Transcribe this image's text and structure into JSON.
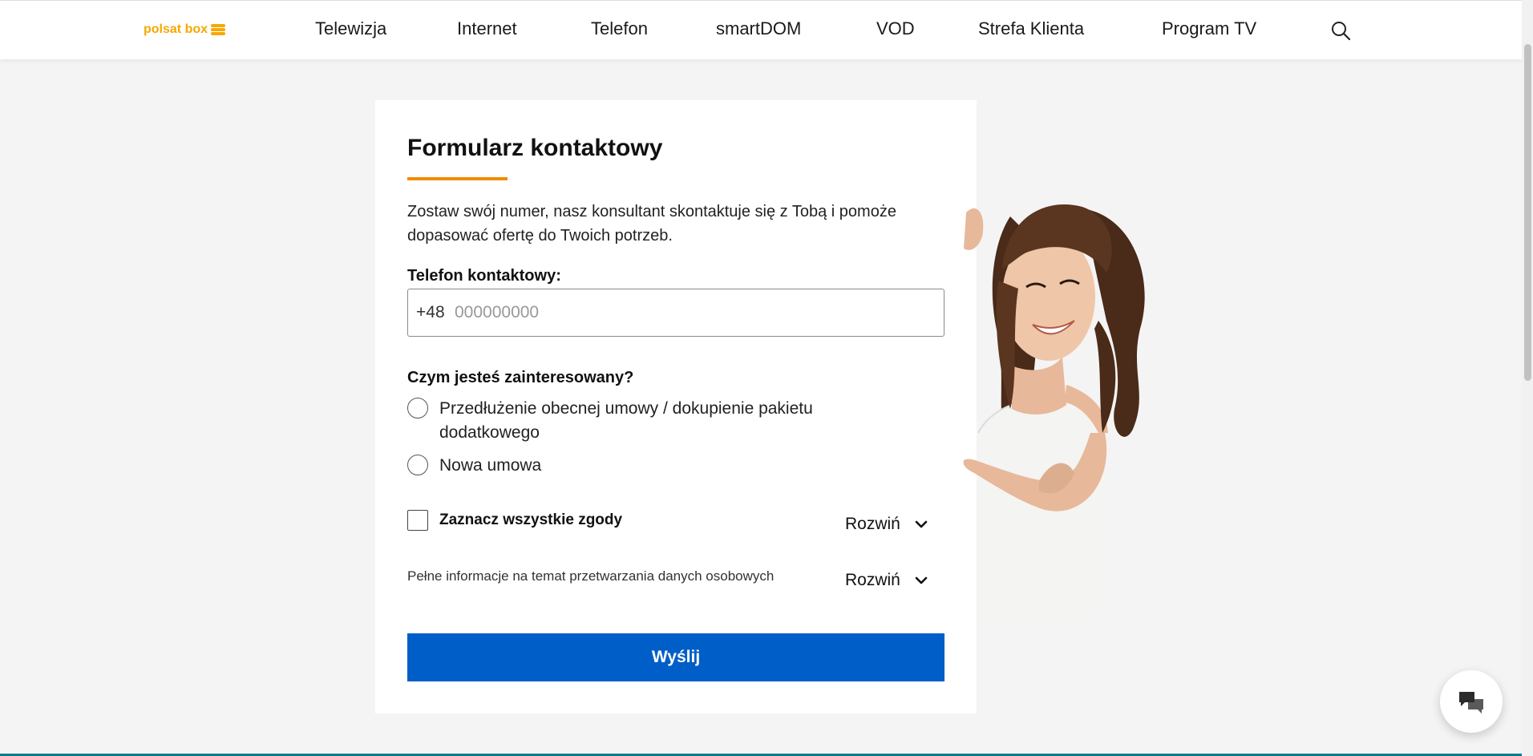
{
  "header": {
    "logo_text": "polsat box",
    "nav": [
      {
        "label": "Telewizja"
      },
      {
        "label": "Internet"
      },
      {
        "label": "Telefon"
      },
      {
        "label": "smartDOM"
      },
      {
        "label": "VOD"
      },
      {
        "label": "Strefa Klienta"
      },
      {
        "label": "Program TV"
      }
    ],
    "search_icon": "search-icon"
  },
  "form": {
    "title": "Formularz kontaktowy",
    "intro": "Zostaw swój numer, nasz konsultant skontaktuje się z Tobą i pomoże dopasować ofertę do Twoich potrzeb.",
    "phone_label": "Telefon kontaktowy:",
    "phone_prefix": "+48",
    "phone_placeholder": "000000000",
    "interest_label": "Czym jesteś zainteresowany?",
    "options": [
      {
        "label": "Przedłużenie obecnej umowy / dokupienie pakietu dodatkowego"
      },
      {
        "label": "Nowa umowa"
      }
    ],
    "consent_label": "Zaznacz wszystkie zgody",
    "expand_label": "Rozwiń",
    "info_text": "Pełne informacje na temat przetwarzania danych osobowych",
    "submit_label": "Wyślij"
  },
  "colors": {
    "accent": "#f28a00",
    "logo": "#f6a800",
    "button": "#005ec8",
    "background": "#f4f4f4"
  },
  "chat": {
    "icon": "chat-bubbles-icon"
  }
}
